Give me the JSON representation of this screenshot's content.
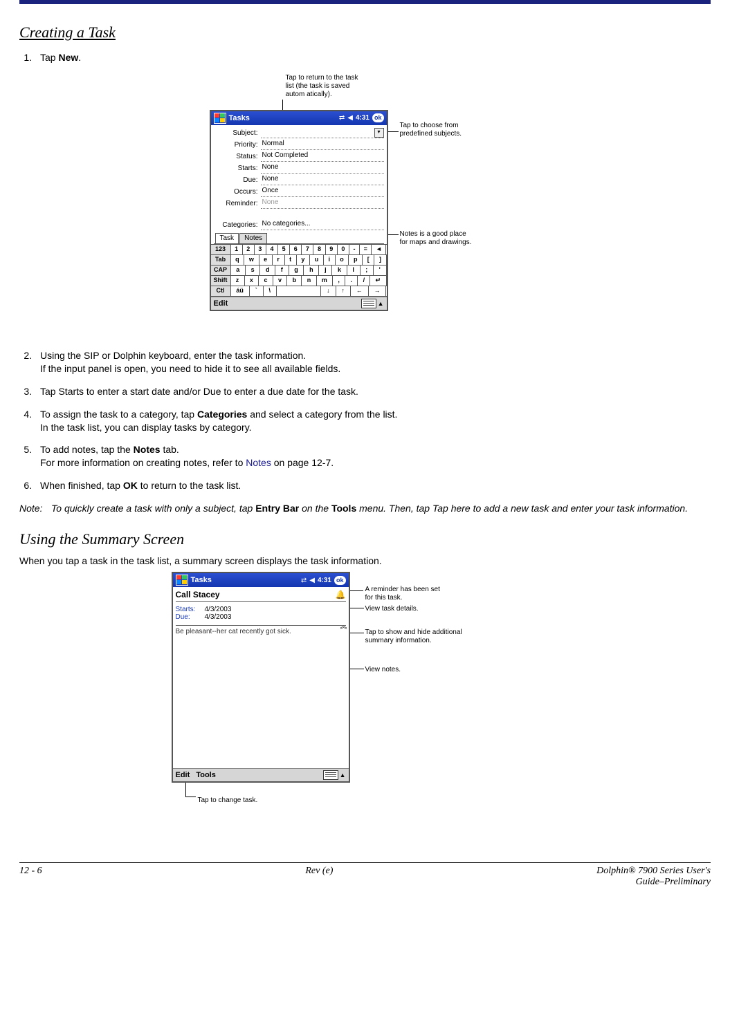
{
  "sections": {
    "creating_task": "Creating a Task",
    "summary_screen": "Using the Summary Screen"
  },
  "steps": {
    "s1": {
      "prefix": "Tap ",
      "bold": "New",
      "suffix": "."
    },
    "s2": "Using the SIP or Dolphin keyboard, enter the task information.",
    "s2b": "If the input panel is open, you need to hide it to see all available fields.",
    "s3": "Tap Starts to enter a start date and/or Due to enter a due date for the task.",
    "s4a": "To assign the task to a category, tap ",
    "s4bold": "Categories",
    "s4b": " and select a category from the list.",
    "s4c": "In the task list, you can display tasks by category.",
    "s5a": "To add notes, tap the ",
    "s5bold": "Notes",
    "s5b": " tab.",
    "s5c_pre": "For more information on creating notes, refer to ",
    "s5c_link": "Notes",
    "s5c_post": " on page 12-7.",
    "s6a": "When finished, tap ",
    "s6bold": "OK",
    "s6b": " to return to the task list."
  },
  "note": {
    "label": "Note:",
    "t1": "To quickly create a task with only a subject, tap ",
    "b1": "Entry Bar",
    "t2": " on the ",
    "b2": "Tools",
    "t3": " menu. Then, tap Tap here to add a new task and enter your task information."
  },
  "summary_intro": "When you tap a task in the task list, a summary screen displays the task information.",
  "fig1": {
    "title": "Tasks",
    "clock": "4:31",
    "ok": "ok",
    "fields": {
      "subject_label": "Subject:",
      "subject_value": "",
      "priority_label": "Priority:",
      "priority_value": "Normal",
      "status_label": "Status:",
      "status_value": "Not Completed",
      "starts_label": "Starts:",
      "starts_value": "None",
      "due_label": "Due:",
      "due_value": "None",
      "occurs_label": "Occurs:",
      "occurs_value": "Once",
      "reminder_label": "Reminder:",
      "reminder_value": "None",
      "categories_label": "Categories:",
      "categories_value": "No categories..."
    },
    "tabs": {
      "task": "Task",
      "notes": "Notes"
    },
    "edit": "Edit",
    "keyboard": {
      "r1": [
        "123",
        "1",
        "2",
        "3",
        "4",
        "5",
        "6",
        "7",
        "8",
        "9",
        "0",
        "-",
        "=",
        "◄"
      ],
      "r2": [
        "Tab",
        "q",
        "w",
        "e",
        "r",
        "t",
        "y",
        "u",
        "i",
        "o",
        "p",
        "[",
        "]"
      ],
      "r3": [
        "CAP",
        "a",
        "s",
        "d",
        "f",
        "g",
        "h",
        "j",
        "k",
        "l",
        ";",
        "'"
      ],
      "r4": [
        "Shift",
        "z",
        "x",
        "c",
        "v",
        "b",
        "n",
        "m",
        ",",
        ".",
        "/",
        "↵"
      ],
      "r5": [
        "Ctl",
        "áü",
        "`",
        "\\",
        "",
        "↓",
        "↑",
        "←",
        "→"
      ]
    },
    "callouts": {
      "top": "Tap to return to the task\nlist (the task is saved\nautom atically).",
      "subject": "Tap to choose from\npredefined subjects.",
      "notes": "Notes is a good place\nfor maps and drawings."
    }
  },
  "fig2": {
    "title": "Tasks",
    "clock": "4:31",
    "ok": "ok",
    "task_name": "Call Stacey",
    "starts_label": "Starts:",
    "starts_value": "4/3/2003",
    "due_label": "Due:",
    "due_value": "4/3/2003",
    "note_text": "Be pleasant--her cat recently got sick.",
    "edit": "Edit",
    "tools": "Tools",
    "callouts": {
      "reminder": "A reminder has been set\nfor this task.",
      "details": "View task details.",
      "toggle": "Tap to show and hide additional\nsummary information.",
      "notes": "View notes.",
      "edit": "Tap to change task."
    }
  },
  "footer": {
    "left": "12 - 6",
    "center": "Rev (e)",
    "right1": "Dolphin® 7900 Series User's",
    "right2": "Guide–Preliminary"
  }
}
